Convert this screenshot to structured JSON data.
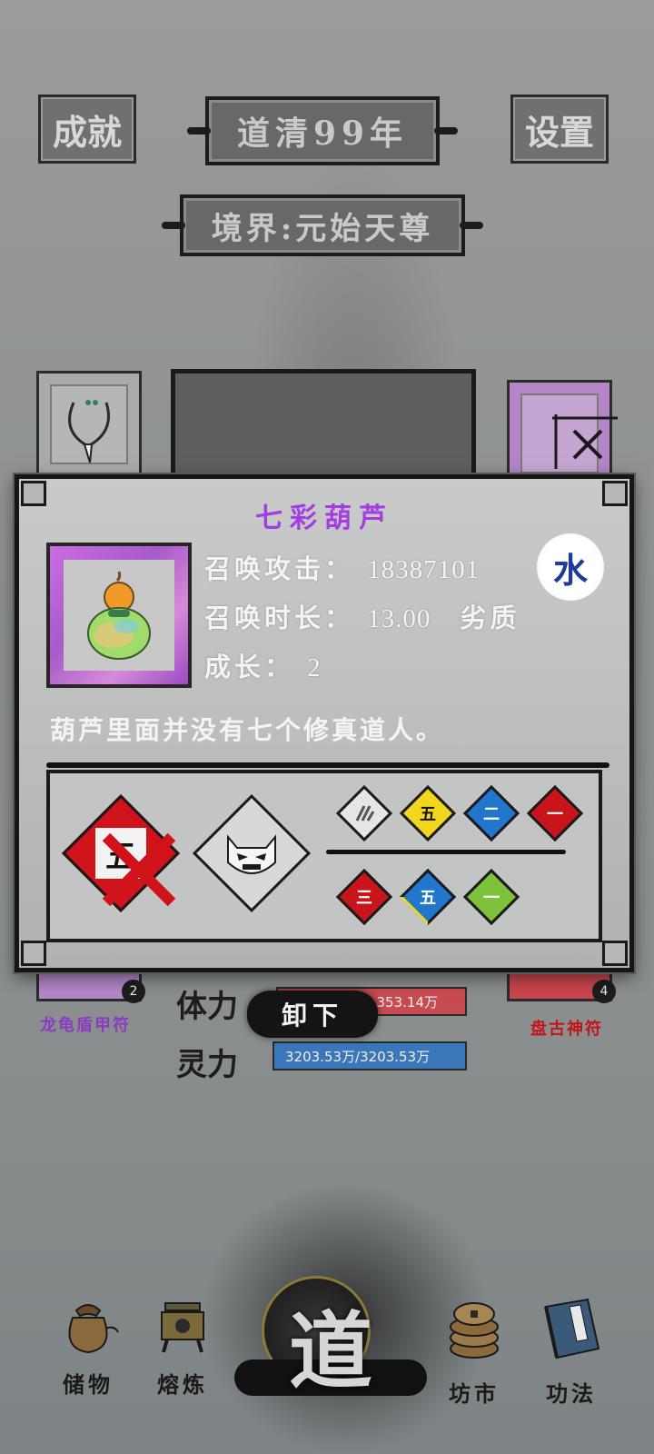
{
  "header": {
    "achievement_label": "成就",
    "year_label": "道清99年",
    "settings_label": "设置",
    "realm_label": "境界:元始天尊"
  },
  "background_slots": {
    "left_label": "龙龟盾甲符",
    "left_number": "2",
    "right_label": "盘古神符",
    "right_number": "4"
  },
  "stats": {
    "hp_label": "体力",
    "hp_value": "353.14万",
    "mp_label": "灵力",
    "mp_value": "3203.53万/3203.53万"
  },
  "popup": {
    "title": "七彩葫芦",
    "attack_label": "召唤攻击：",
    "attack_value": "18387101",
    "duration_label": "召唤时长：",
    "duration_value": "13.00",
    "quality": "劣质",
    "growth_label": "成长：",
    "growth_value": "2",
    "element": "水",
    "description": "葫芦里面并没有七个修真道人。",
    "skills": {
      "main_rank": "五",
      "small_row1": [
        "",
        "五",
        "二",
        "一"
      ],
      "small_row2": [
        "三",
        "五",
        "一"
      ]
    },
    "colors": {
      "title": "#a23ee0",
      "element": "#1f3a9a",
      "red": "#c9141a",
      "yellow": "#f2d71e",
      "blue": "#2277cc",
      "green": "#7cc23a"
    }
  },
  "unequip_label": "卸下",
  "nav": {
    "storage": "储物",
    "smelt": "熔炼",
    "center": "道",
    "market": "坊市",
    "skills": "功法"
  }
}
